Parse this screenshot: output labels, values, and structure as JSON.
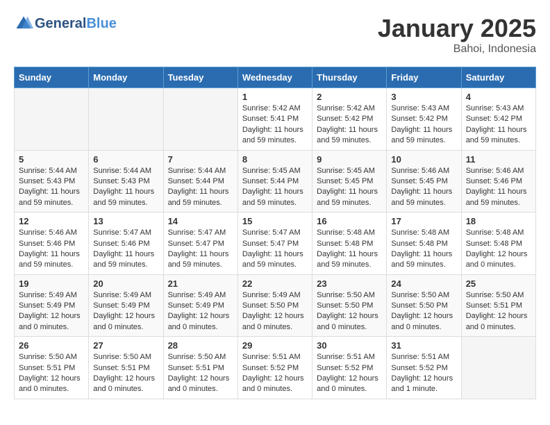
{
  "header": {
    "logo_line1": "General",
    "logo_line2": "Blue",
    "month": "January 2025",
    "location": "Bahoi, Indonesia"
  },
  "weekdays": [
    "Sunday",
    "Monday",
    "Tuesday",
    "Wednesday",
    "Thursday",
    "Friday",
    "Saturday"
  ],
  "weeks": [
    [
      {
        "day": "",
        "info": ""
      },
      {
        "day": "",
        "info": ""
      },
      {
        "day": "",
        "info": ""
      },
      {
        "day": "1",
        "info": "Sunrise: 5:42 AM\nSunset: 5:41 PM\nDaylight: 11 hours\nand 59 minutes."
      },
      {
        "day": "2",
        "info": "Sunrise: 5:42 AM\nSunset: 5:42 PM\nDaylight: 11 hours\nand 59 minutes."
      },
      {
        "day": "3",
        "info": "Sunrise: 5:43 AM\nSunset: 5:42 PM\nDaylight: 11 hours\nand 59 minutes."
      },
      {
        "day": "4",
        "info": "Sunrise: 5:43 AM\nSunset: 5:42 PM\nDaylight: 11 hours\nand 59 minutes."
      }
    ],
    [
      {
        "day": "5",
        "info": "Sunrise: 5:44 AM\nSunset: 5:43 PM\nDaylight: 11 hours\nand 59 minutes."
      },
      {
        "day": "6",
        "info": "Sunrise: 5:44 AM\nSunset: 5:43 PM\nDaylight: 11 hours\nand 59 minutes."
      },
      {
        "day": "7",
        "info": "Sunrise: 5:44 AM\nSunset: 5:44 PM\nDaylight: 11 hours\nand 59 minutes."
      },
      {
        "day": "8",
        "info": "Sunrise: 5:45 AM\nSunset: 5:44 PM\nDaylight: 11 hours\nand 59 minutes."
      },
      {
        "day": "9",
        "info": "Sunrise: 5:45 AM\nSunset: 5:45 PM\nDaylight: 11 hours\nand 59 minutes."
      },
      {
        "day": "10",
        "info": "Sunrise: 5:46 AM\nSunset: 5:45 PM\nDaylight: 11 hours\nand 59 minutes."
      },
      {
        "day": "11",
        "info": "Sunrise: 5:46 AM\nSunset: 5:46 PM\nDaylight: 11 hours\nand 59 minutes."
      }
    ],
    [
      {
        "day": "12",
        "info": "Sunrise: 5:46 AM\nSunset: 5:46 PM\nDaylight: 11 hours\nand 59 minutes."
      },
      {
        "day": "13",
        "info": "Sunrise: 5:47 AM\nSunset: 5:46 PM\nDaylight: 11 hours\nand 59 minutes."
      },
      {
        "day": "14",
        "info": "Sunrise: 5:47 AM\nSunset: 5:47 PM\nDaylight: 11 hours\nand 59 minutes."
      },
      {
        "day": "15",
        "info": "Sunrise: 5:47 AM\nSunset: 5:47 PM\nDaylight: 11 hours\nand 59 minutes."
      },
      {
        "day": "16",
        "info": "Sunrise: 5:48 AM\nSunset: 5:48 PM\nDaylight: 11 hours\nand 59 minutes."
      },
      {
        "day": "17",
        "info": "Sunrise: 5:48 AM\nSunset: 5:48 PM\nDaylight: 11 hours\nand 59 minutes."
      },
      {
        "day": "18",
        "info": "Sunrise: 5:48 AM\nSunset: 5:48 PM\nDaylight: 12 hours\nand 0 minutes."
      }
    ],
    [
      {
        "day": "19",
        "info": "Sunrise: 5:49 AM\nSunset: 5:49 PM\nDaylight: 12 hours\nand 0 minutes."
      },
      {
        "day": "20",
        "info": "Sunrise: 5:49 AM\nSunset: 5:49 PM\nDaylight: 12 hours\nand 0 minutes."
      },
      {
        "day": "21",
        "info": "Sunrise: 5:49 AM\nSunset: 5:49 PM\nDaylight: 12 hours\nand 0 minutes."
      },
      {
        "day": "22",
        "info": "Sunrise: 5:49 AM\nSunset: 5:50 PM\nDaylight: 12 hours\nand 0 minutes."
      },
      {
        "day": "23",
        "info": "Sunrise: 5:50 AM\nSunset: 5:50 PM\nDaylight: 12 hours\nand 0 minutes."
      },
      {
        "day": "24",
        "info": "Sunrise: 5:50 AM\nSunset: 5:50 PM\nDaylight: 12 hours\nand 0 minutes."
      },
      {
        "day": "25",
        "info": "Sunrise: 5:50 AM\nSunset: 5:51 PM\nDaylight: 12 hours\nand 0 minutes."
      }
    ],
    [
      {
        "day": "26",
        "info": "Sunrise: 5:50 AM\nSunset: 5:51 PM\nDaylight: 12 hours\nand 0 minutes."
      },
      {
        "day": "27",
        "info": "Sunrise: 5:50 AM\nSunset: 5:51 PM\nDaylight: 12 hours\nand 0 minutes."
      },
      {
        "day": "28",
        "info": "Sunrise: 5:50 AM\nSunset: 5:51 PM\nDaylight: 12 hours\nand 0 minutes."
      },
      {
        "day": "29",
        "info": "Sunrise: 5:51 AM\nSunset: 5:52 PM\nDaylight: 12 hours\nand 0 minutes."
      },
      {
        "day": "30",
        "info": "Sunrise: 5:51 AM\nSunset: 5:52 PM\nDaylight: 12 hours\nand 0 minutes."
      },
      {
        "day": "31",
        "info": "Sunrise: 5:51 AM\nSunset: 5:52 PM\nDaylight: 12 hours\nand 1 minute."
      },
      {
        "day": "",
        "info": ""
      }
    ]
  ]
}
